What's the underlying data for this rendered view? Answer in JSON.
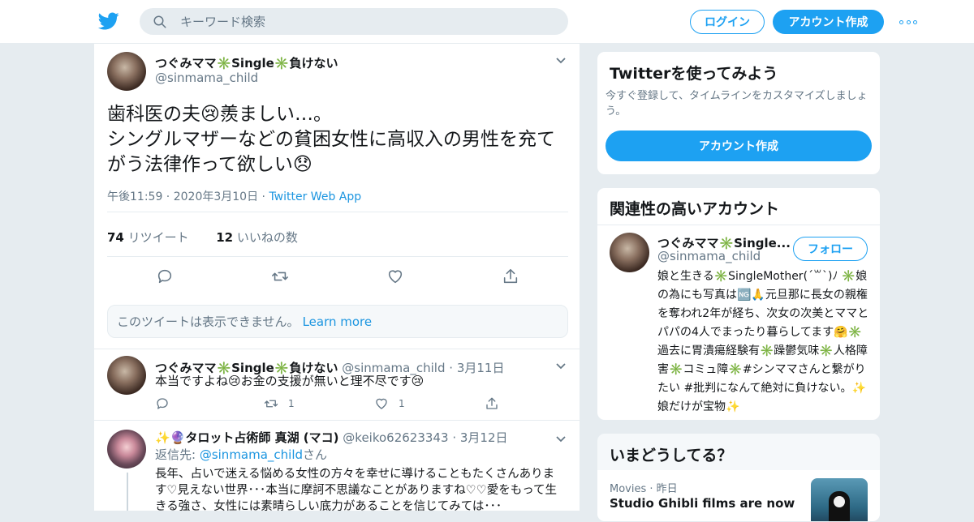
{
  "header": {
    "search_placeholder": "キーワード検索",
    "login_label": "ログイン",
    "signup_label": "アカウント作成"
  },
  "tweet": {
    "author_name": "つぐみママ✳️Single✳️負けない",
    "author_handle": "@sinmama_child",
    "text_line1": "歯科医の夫😢羨ましい…。",
    "text_line2": "シングルマザーなどの貧困女性に高収入の男性を充てがう法律作って欲しい😞",
    "time": "午後11:59",
    "date": "2020年3月10日",
    "source": "Twitter Web App",
    "retweets_count": "74",
    "retweets_label": "リツイート",
    "likes_count": "12",
    "likes_label": "いいねの数"
  },
  "withheld": {
    "text": "このツイートは表示できません。",
    "link": "Learn more"
  },
  "replies": [
    {
      "name": "つぐみママ✳️Single✳️負けない",
      "handle": "@sinmama_child",
      "date": "3月11日",
      "text": "本当ですよね😢お金の支援が無いと理不尽です😢",
      "retweets": "1",
      "likes": "1"
    },
    {
      "name": "✨🔮タロット占術師 真湖 (マコ)",
      "handle": "@keiko62623343",
      "date": "3月12日",
      "reply_prefix": "返信先: ",
      "reply_to": "@sinmama_child",
      "reply_suffix": "さん",
      "text": "長年、占いで迷える悩める女性の方々を幸せに導けることもたくさんあります♡見えない世界･･･本当に摩訶不思議なことがありますね♡♡愛をもって生きる強さ、女性には素晴らしい底力があることを信じてみては･･･"
    }
  ],
  "signup_card": {
    "title": "Twitterを使ってみよう",
    "subtitle": "今すぐ登録して、タイムラインをカスタマイズしましょう。",
    "button": "アカウント作成"
  },
  "related": {
    "title": "関連性の高いアカウント",
    "name": "つぐみママ✳️Single...",
    "handle": "@sinmama_child",
    "follow_label": "フォロー",
    "bio": "娘と生きる✳️SingleMother(´꒳`)ﾉ ✳️娘の為にも写真は🆖🙏元旦那に長女の親権を奪われ2年が経ち、次女の次美とママとパパの4人でまったり暮らしてます🤗✳️過去に胃潰瘍経験有✳️躁鬱気味✳️人格障害✳️コミュ障✳️#シンママさんと繋がりたい #批判になんて絶対に負けない。✨娘だけが宝物✨"
  },
  "trends": {
    "title": "いまどうしてる？",
    "category": "Movies",
    "when": "昨日",
    "headline": "Studio Ghibli films are now"
  },
  "colors": {
    "accent": "#1da1f2",
    "link": "#1b95e0",
    "secondary_text": "#657786",
    "background": "#e6ecf0"
  }
}
